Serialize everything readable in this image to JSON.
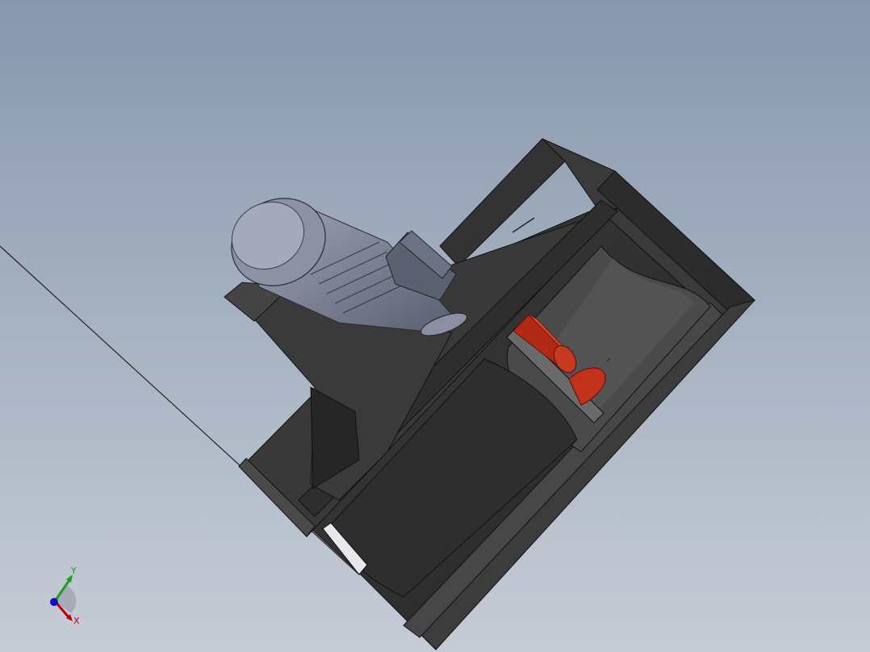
{
  "viewport": {
    "background_top": "#8798ad",
    "background_bottom": "#c6ccd6"
  },
  "model": {
    "housing_color": "#3a3a3a",
    "housing_dark": "#242424",
    "housing_light": "#505050",
    "motor_color": "#767b8d",
    "motor_light": "#9aa0b2",
    "impeller_color": "#c0321c",
    "impeller_dark": "#8c1f10",
    "edge_color": "#111111"
  },
  "triad": {
    "x_label": "X",
    "y_label": "Y",
    "x_color": "#c00000",
    "y_color": "#1aa01a",
    "z_color": "#1010c0"
  }
}
